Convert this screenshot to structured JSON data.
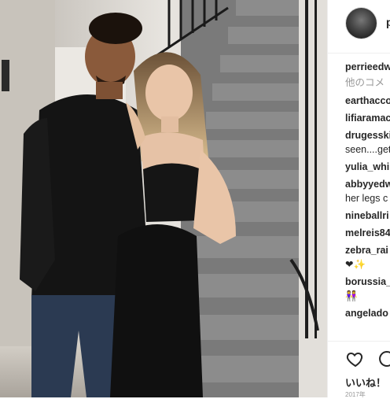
{
  "post": {
    "header_username": "p",
    "caption_username": "perrieedw",
    "more_comments": "他のコメ",
    "comments": [
      {
        "user": "earthacco",
        "text": ""
      },
      {
        "user": "lifiaramac",
        "text": ""
      },
      {
        "user": "drugesski",
        "text": "",
        "line2": "seen....get"
      },
      {
        "user": "yulia_whi",
        "text": ""
      },
      {
        "user": "abbyyedw",
        "text": "",
        "line2": "her legs c"
      },
      {
        "user": "nineballri",
        "text": ""
      },
      {
        "user": "melreis84",
        "text": ""
      },
      {
        "user": "zebra_rai",
        "text": "",
        "line2": "❤✨"
      },
      {
        "user": "borussia_",
        "text": "",
        "line2": "👭"
      },
      {
        "user": "angelado",
        "text": ""
      }
    ],
    "likes_label": "いいね！",
    "date": "2017年"
  },
  "colors": {
    "text": "#262626",
    "muted": "#999999",
    "border": "#efefef"
  }
}
